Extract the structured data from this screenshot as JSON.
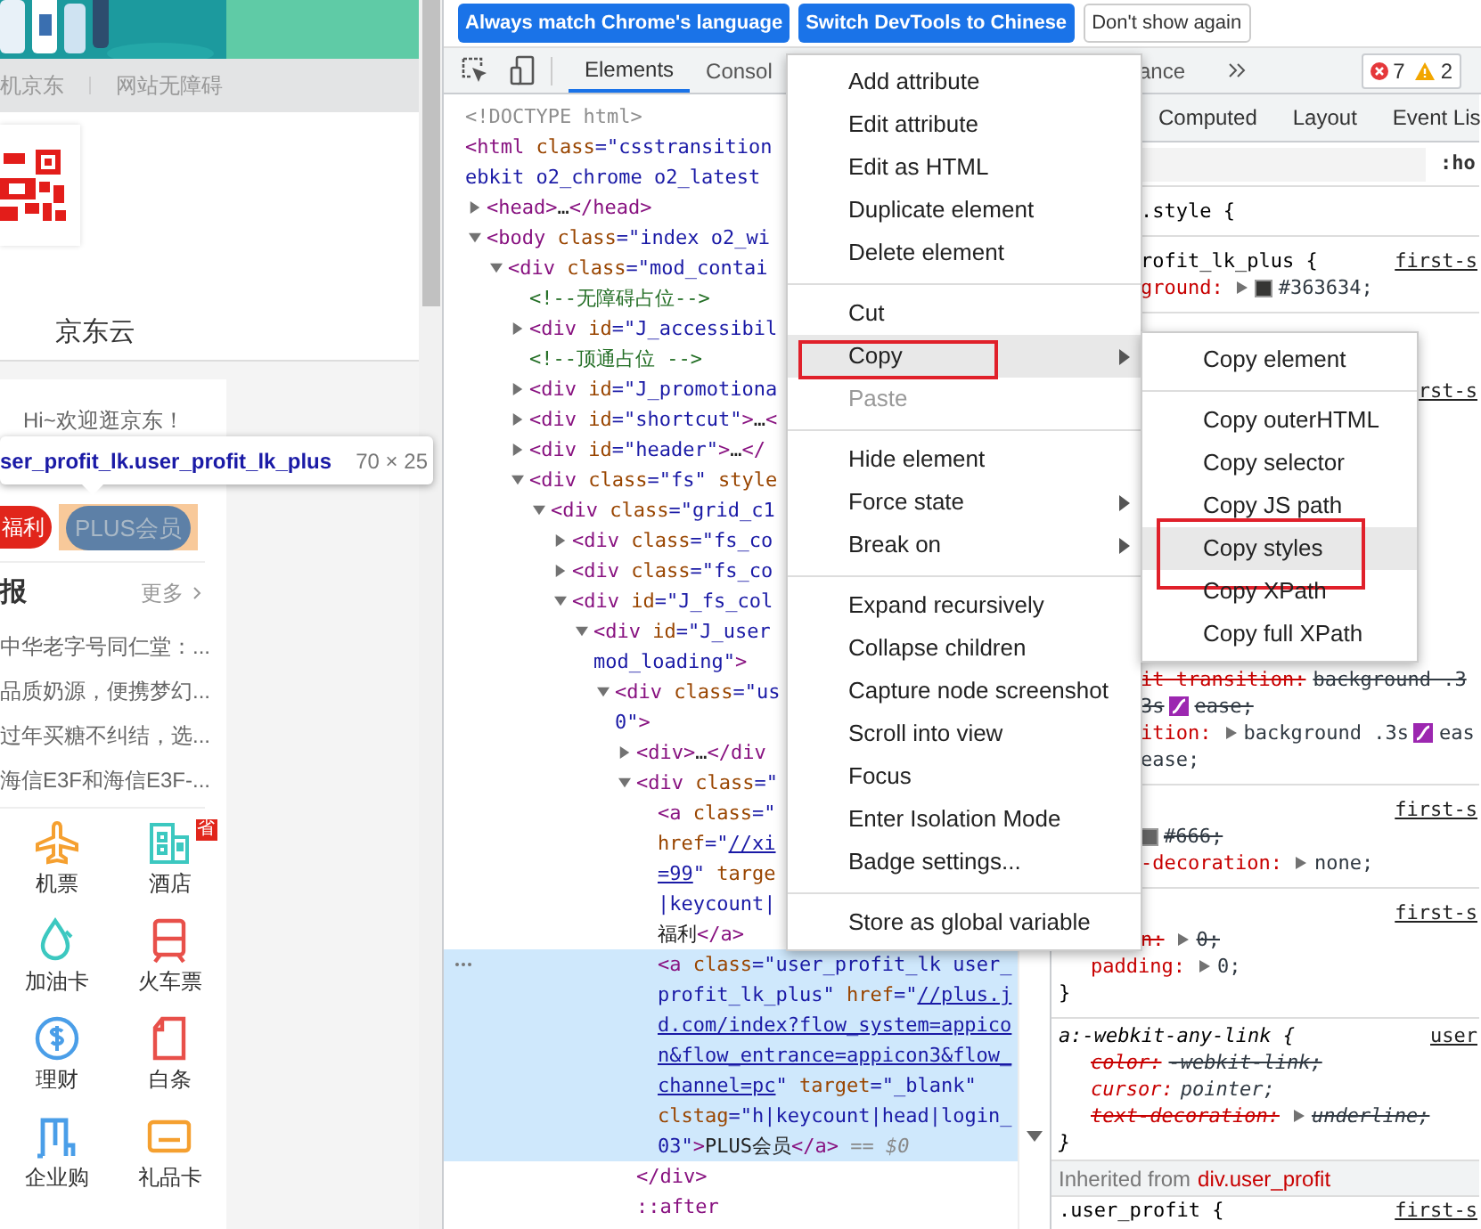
{
  "page": {
    "banner": {
      "kind": "picture"
    },
    "top_links": [
      "机京东",
      "网站无障碍"
    ],
    "nav": [
      "京东云"
    ],
    "greeting": "Hi~欢迎逛京东！",
    "tooltip": {
      "selector": "ser_profit_lk.user_profit_lk_plus",
      "size": "70 × 25"
    },
    "pills": [
      {
        "label": "福利",
        "kind": "red"
      },
      {
        "label": "PLUS会员",
        "kind": "inspected"
      }
    ],
    "news": {
      "title": "报",
      "more": "更多",
      "items": [
        "中华老字号同仁堂：...",
        "品质奶源，便携梦幻...",
        "过年买糖不纠结，选...",
        "海信E3F和海信E3F-..."
      ]
    },
    "services": [
      {
        "label": "机票",
        "kind": "plane",
        "color": "#f5a030"
      },
      {
        "label": "酒店",
        "kind": "hotel",
        "color": "#3cc8c0"
      },
      {
        "label": "加油卡",
        "kind": "fuel",
        "color": "#3cc8c0"
      },
      {
        "label": "火车票",
        "kind": "train",
        "color": "#e8504a"
      },
      {
        "label": "理财",
        "kind": "finance",
        "color": "#4a9ee8"
      },
      {
        "label": "白条",
        "kind": "iou",
        "color": "#e8504a"
      },
      {
        "label": "企业购",
        "kind": "enterprise",
        "color": "#4a9ee8"
      },
      {
        "label": "礼品卡",
        "kind": "card",
        "color": "#f5a030"
      }
    ],
    "service_badge": {
      "text": "省"
    }
  },
  "infobar": {
    "buttons": [
      {
        "label": "Always match Chrome's language",
        "kind": "primary"
      },
      {
        "label": "Switch DevTools to Chinese",
        "kind": "primary"
      },
      {
        "label": "Don't show again",
        "kind": "secondary"
      }
    ]
  },
  "toolbar": {
    "tabs": [
      {
        "label": "Elements",
        "selected": true
      },
      {
        "label": "Consol",
        "selected": false
      },
      {
        "label": "ance",
        "selected": false
      }
    ],
    "errors": "7",
    "warnings": "2"
  },
  "elements": {
    "nodes": [
      {
        "selected": false,
        "lines": [
          [
            {
              "kind": "doctype",
              "text": "<!DOCTYPE html>"
            }
          ]
        ]
      },
      {
        "selected": false,
        "lines": [
          [
            {
              "kind": "tag",
              "text": "<html"
            },
            {
              "kind": "attr",
              "text": " class"
            },
            {
              "kind": "val",
              "text": "=\"csstransition"
            }
          ],
          [
            {
              "kind": "val",
              "text": "ebkit o2_chrome o2_latest"
            }
          ]
        ],
        "children": [
          {
            "selected": false,
            "expanded": false,
            "lines": [
              [
                {
                  "kind": "tag",
                  "text": "<head>"
                },
                {
                  "kind": "text",
                  "text": "…"
                },
                {
                  "kind": "tag",
                  "text": "</head>"
                }
              ]
            ]
          },
          {
            "selected": false,
            "expanded": true,
            "lines": [
              [
                {
                  "kind": "tag",
                  "text": "<body"
                },
                {
                  "kind": "attr",
                  "text": " class"
                },
                {
                  "kind": "val",
                  "text": "=\"index o2_wi"
                }
              ]
            ],
            "children": [
              {
                "selected": false,
                "expanded": true,
                "lines": [
                  [
                    {
                      "kind": "tag",
                      "text": "<div"
                    },
                    {
                      "kind": "attr",
                      "text": " class"
                    },
                    {
                      "kind": "val",
                      "text": "=\"mod_contai"
                    }
                  ]
                ],
                "children": [
                  {
                    "selected": false,
                    "lines": [
                      [
                        {
                          "kind": "comment",
                          "text": "<!--无障碍占位-->"
                        }
                      ]
                    ]
                  },
                  {
                    "selected": false,
                    "expanded": false,
                    "lines": [
                      [
                        {
                          "kind": "tag",
                          "text": "<div"
                        },
                        {
                          "kind": "attr",
                          "text": " id"
                        },
                        {
                          "kind": "val",
                          "text": "=\"J_accessibil"
                        }
                      ]
                    ]
                  },
                  {
                    "selected": false,
                    "lines": [
                      [
                        {
                          "kind": "comment",
                          "text": "<!--顶通占位 -->"
                        }
                      ]
                    ]
                  },
                  {
                    "selected": false,
                    "expanded": false,
                    "lines": [
                      [
                        {
                          "kind": "tag",
                          "text": "<div"
                        },
                        {
                          "kind": "attr",
                          "text": " id"
                        },
                        {
                          "kind": "val",
                          "text": "=\"J_promotiona"
                        }
                      ]
                    ]
                  },
                  {
                    "selected": false,
                    "expanded": false,
                    "lines": [
                      [
                        {
                          "kind": "tag",
                          "text": "<div"
                        },
                        {
                          "kind": "attr",
                          "text": " id"
                        },
                        {
                          "kind": "val",
                          "text": "=\"shortcut\""
                        },
                        {
                          "kind": "tag",
                          "text": ">"
                        },
                        {
                          "kind": "text",
                          "text": "…"
                        },
                        {
                          "kind": "tag",
                          "text": "<"
                        }
                      ]
                    ]
                  },
                  {
                    "selected": false,
                    "expanded": false,
                    "lines": [
                      [
                        {
                          "kind": "tag",
                          "text": "<div"
                        },
                        {
                          "kind": "attr",
                          "text": " id"
                        },
                        {
                          "kind": "val",
                          "text": "=\"header\""
                        },
                        {
                          "kind": "tag",
                          "text": ">"
                        },
                        {
                          "kind": "text",
                          "text": "…"
                        },
                        {
                          "kind": "tag",
                          "text": "</"
                        }
                      ]
                    ]
                  },
                  {
                    "selected": false,
                    "expanded": true,
                    "lines": [
                      [
                        {
                          "kind": "tag",
                          "text": "<div"
                        },
                        {
                          "kind": "attr",
                          "text": " class"
                        },
                        {
                          "kind": "val",
                          "text": "=\"fs\""
                        },
                        {
                          "kind": "attr",
                          "text": " style"
                        }
                      ]
                    ],
                    "children": [
                      {
                        "selected": false,
                        "expanded": true,
                        "lines": [
                          [
                            {
                              "kind": "tag",
                              "text": "<div"
                            },
                            {
                              "kind": "attr",
                              "text": " class"
                            },
                            {
                              "kind": "val",
                              "text": "=\"grid_c1"
                            }
                          ]
                        ],
                        "children": [
                          {
                            "selected": false,
                            "expanded": false,
                            "lines": [
                              [
                                {
                                  "kind": "tag",
                                  "text": "<div"
                                },
                                {
                                  "kind": "attr",
                                  "text": " class"
                                },
                                {
                                  "kind": "val",
                                  "text": "=\"fs_co"
                                }
                              ]
                            ]
                          },
                          {
                            "selected": false,
                            "expanded": false,
                            "lines": [
                              [
                                {
                                  "kind": "tag",
                                  "text": "<div"
                                },
                                {
                                  "kind": "attr",
                                  "text": " class"
                                },
                                {
                                  "kind": "val",
                                  "text": "=\"fs_co"
                                }
                              ]
                            ]
                          },
                          {
                            "selected": false,
                            "expanded": true,
                            "lines": [
                              [
                                {
                                  "kind": "tag",
                                  "text": "<div"
                                },
                                {
                                  "kind": "attr",
                                  "text": " id"
                                },
                                {
                                  "kind": "val",
                                  "text": "=\"J_fs_col"
                                }
                              ]
                            ],
                            "children": [
                              {
                                "selected": false,
                                "expanded": true,
                                "lines": [
                                  [
                                    {
                                      "kind": "tag",
                                      "text": "<div"
                                    },
                                    {
                                      "kind": "attr",
                                      "text": " id"
                                    },
                                    {
                                      "kind": "val",
                                      "text": "=\"J_user"
                                    }
                                  ],
                                  [
                                    {
                                      "kind": "val",
                                      "text": "mod_loading\""
                                    },
                                    {
                                      "kind": "tag",
                                      "text": ">"
                                    }
                                  ]
                                ],
                                "children": [
                                  {
                                    "selected": false,
                                    "expanded": true,
                                    "lines": [
                                      [
                                        {
                                          "kind": "tag",
                                          "text": "<div"
                                        },
                                        {
                                          "kind": "attr",
                                          "text": " class"
                                        },
                                        {
                                          "kind": "val",
                                          "text": "=\"us"
                                        }
                                      ],
                                      [
                                        {
                                          "kind": "val",
                                          "text": "0\""
                                        },
                                        {
                                          "kind": "tag",
                                          "text": ">"
                                        }
                                      ]
                                    ],
                                    "children": [
                                      {
                                        "selected": false,
                                        "expanded": false,
                                        "lines": [
                                          [
                                            {
                                              "kind": "tag",
                                              "text": "<div>"
                                            },
                                            {
                                              "kind": "text",
                                              "text": "…"
                                            },
                                            {
                                              "kind": "tag",
                                              "text": "</div"
                                            }
                                          ]
                                        ]
                                      },
                                      {
                                        "selected": false,
                                        "expanded": true,
                                        "lines": [
                                          [
                                            {
                                              "kind": "tag",
                                              "text": "<div"
                                            },
                                            {
                                              "kind": "attr",
                                              "text": " class"
                                            },
                                            {
                                              "kind": "val",
                                              "text": "=\""
                                            }
                                          ]
                                        ],
                                        "closing": [
                                          {
                                            "kind": "tag",
                                            "text": "</div>"
                                          }
                                        ],
                                        "children": [
                                          {
                                            "selected": false,
                                            "lines": [
                                              [
                                                {
                                                  "kind": "tag",
                                                  "text": "<a"
                                                },
                                                {
                                                  "kind": "attr",
                                                  "text": " class"
                                                },
                                                {
                                                  "kind": "val",
                                                  "text": "=\""
                                                }
                                              ],
                                              [
                                                {
                                                  "kind": "attr",
                                                  "text": "href"
                                                },
                                                {
                                                  "kind": "val",
                                                  "text": "=\""
                                                },
                                                {
                                                  "kind": "link",
                                                  "text": "//xi"
                                                }
                                              ],
                                              [
                                                {
                                                  "kind": "link",
                                                  "text": "=99"
                                                },
                                                {
                                                  "kind": "val",
                                                  "text": "\""
                                                },
                                                {
                                                  "kind": "attr",
                                                  "text": " targe"
                                                }
                                              ],
                                              [
                                                {
                                                  "kind": "val",
                                                  "text": "|keycount|"
                                                }
                                              ],
                                              [
                                                {
                                                  "kind": "text",
                                                  "text": "福利"
                                                },
                                                {
                                                  "kind": "tag",
                                                  "text": "</a>"
                                                }
                                              ]
                                            ]
                                          },
                                          {
                                            "selected": true,
                                            "lines": [
                                              [
                                                {
                                                  "kind": "tag",
                                                  "text": "<a"
                                                },
                                                {
                                                  "kind": "attr",
                                                  "text": " class"
                                                },
                                                {
                                                  "kind": "val",
                                                  "text": "=\"user_profit_lk user_"
                                                }
                                              ],
                                              [
                                                {
                                                  "kind": "val",
                                                  "text": "profit_lk_plus\""
                                                },
                                                {
                                                  "kind": "attr",
                                                  "text": " href"
                                                },
                                                {
                                                  "kind": "val",
                                                  "text": "=\""
                                                },
                                                {
                                                  "kind": "link",
                                                  "text": "//plus.j"
                                                }
                                              ],
                                              [
                                                {
                                                  "kind": "link",
                                                  "text": "d.com/index?flow_system=appico"
                                                }
                                              ],
                                              [
                                                {
                                                  "kind": "link",
                                                  "text": "n&flow_entrance=appicon3&flow_"
                                                }
                                              ],
                                              [
                                                {
                                                  "kind": "link",
                                                  "text": "channel=pc"
                                                },
                                                {
                                                  "kind": "val",
                                                  "text": "\""
                                                },
                                                {
                                                  "kind": "attr",
                                                  "text": " target"
                                                },
                                                {
                                                  "kind": "val",
                                                  "text": "=\"_blank\""
                                                }
                                              ],
                                              [
                                                {
                                                  "kind": "attr",
                                                  "text": "clstag"
                                                },
                                                {
                                                  "kind": "val",
                                                  "text": "=\"h|keycount|head|login_"
                                                }
                                              ],
                                              [
                                                {
                                                  "kind": "val",
                                                  "text": "03\""
                                                },
                                                {
                                                  "kind": "tag",
                                                  "text": ">"
                                                },
                                                {
                                                  "kind": "text",
                                                  "text": "PLUS会员"
                                                },
                                                {
                                                  "kind": "tag",
                                                  "text": "</a>"
                                                },
                                                {
                                                  "kind": "dim",
                                                  "text": " == $0"
                                                }
                                              ]
                                            ]
                                          }
                                        ]
                                      },
                                      {
                                        "selected": false,
                                        "lines": [
                                          [
                                            {
                                              "kind": "pseudo",
                                              "text": "::after"
                                            }
                                          ]
                                        ]
                                      }
                                    ]
                                  }
                                ]
                              }
                            ]
                          }
                        ]
                      }
                    ]
                  }
                ]
              }
            ]
          }
        ]
      }
    ]
  },
  "styles": {
    "tabs": [
      {
        "label": "Computed",
        "selected": false
      },
      {
        "label": "Layout",
        "selected": false
      },
      {
        "label": "Event Lis",
        "selected": false
      }
    ],
    "hover_toggle": ":ho",
    "rules": [
      {
        "kind": "plain",
        "lines": [
          {
            "kind": "cut",
            "parts": [
              {
                "kind": "selector",
                "text": ".style {"
              }
            ]
          }
        ]
      },
      {
        "kind": "plain",
        "lines": [
          {
            "kind": "cut",
            "source": "first-s",
            "parts": [
              {
                "kind": "selector",
                "text": "rofit_lk_plus {"
              }
            ]
          },
          {
            "kind": "cut",
            "struck": false,
            "parts": [
              {
                "kind": "prop",
                "text": "ground:"
              },
              {
                "kind": "expander"
              },
              {
                "kind": "swatch",
                "color": "#363634"
              },
              {
                "kind": "value",
                "text": "#363634;"
              }
            ]
          }
        ]
      },
      {
        "kind": "covered",
        "lines": [
          {
            "kind": "cut",
            "source": "rst-s"
          },
          {
            "kind": "cut",
            "struck": true,
            "parts": [
              {
                "kind": "prop",
                "text": "it transition:"
              },
              {
                "kind": "value",
                "text": "background .3"
              }
            ]
          },
          {
            "kind": "cut",
            "struck": true,
            "parts": [
              {
                "kind": "value",
                "text": "3s"
              },
              {
                "kind": "easing"
              },
              {
                "kind": "value",
                "text": "ease;"
              }
            ]
          },
          {
            "kind": "cut",
            "struck": false,
            "parts": [
              {
                "kind": "prop",
                "text": "ition:"
              },
              {
                "kind": "expander"
              },
              {
                "kind": "value",
                "text": "background .3s"
              },
              {
                "kind": "easing"
              },
              {
                "kind": "value",
                "text": "eas"
              }
            ]
          },
          {
            "kind": "cut",
            "struck": false,
            "parts": [
              {
                "kind": "value",
                "text": "ease;"
              }
            ]
          }
        ]
      },
      {
        "kind": "plain",
        "lines": [
          {
            "kind": "cut",
            "source": "first-s"
          },
          {
            "kind": "cut",
            "struck": true,
            "parts": [
              {
                "kind": "swatch",
                "color": "#666666"
              },
              {
                "kind": "value",
                "text": "#666;"
              }
            ]
          },
          {
            "kind": "cut",
            "struck": false,
            "parts": [
              {
                "kind": "prop",
                "text": "-decoration:"
              },
              {
                "kind": "expander"
              },
              {
                "kind": "value",
                "text": "none;"
              }
            ]
          }
        ]
      },
      {
        "kind": "plain",
        "lines": [
          {
            "kind": "cut",
            "source": "first-s"
          },
          {
            "kind": "cut",
            "struck": true,
            "parts": [
              {
                "kind": "prop",
                "text": "n:"
              },
              {
                "kind": "expander"
              },
              {
                "kind": "value",
                "text": "0;"
              }
            ]
          },
          {
            "kind": "decl",
            "struck": false,
            "parts": [
              {
                "kind": "prop",
                "text": "padding:"
              },
              {
                "kind": "expander"
              },
              {
                "kind": "value",
                "text": "0;"
              }
            ]
          },
          {
            "kind": "brace",
            "parts": [
              {
                "kind": "selector",
                "text": "}"
              }
            ]
          }
        ]
      },
      {
        "kind": "user_agent",
        "lines": [
          {
            "kind": "selector",
            "source": "user",
            "parts": [
              {
                "kind": "selector",
                "text": "a:-webkit-any-link {"
              }
            ]
          },
          {
            "kind": "decl",
            "struck": true,
            "parts": [
              {
                "kind": "prop",
                "text": "color:"
              },
              {
                "kind": "value",
                "text": "-webkit-link;"
              }
            ]
          },
          {
            "kind": "decl",
            "struck": false,
            "parts": [
              {
                "kind": "prop",
                "text": "cursor:"
              },
              {
                "kind": "value",
                "text": "pointer;"
              }
            ]
          },
          {
            "kind": "decl",
            "struck": true,
            "parts": [
              {
                "kind": "prop",
                "text": "text-decoration:"
              },
              {
                "kind": "expander"
              },
              {
                "kind": "value",
                "text": "underline;"
              }
            ]
          },
          {
            "kind": "brace",
            "parts": [
              {
                "kind": "selector",
                "text": "}"
              }
            ]
          }
        ]
      }
    ],
    "inherited": {
      "label": "Inherited from",
      "element": "div.user_profit",
      "lines": [
        {
          "kind": "selector",
          "source": "first-s",
          "parts": [
            {
              "kind": "selector",
              "text": ".user_profit {"
            }
          ]
        }
      ]
    }
  },
  "context_menu": {
    "items": [
      {
        "kind": "item",
        "label": "Add attribute",
        "selected": false,
        "disabled": false,
        "submenu": false,
        "marked": false
      },
      {
        "kind": "item",
        "label": "Edit attribute",
        "selected": false,
        "disabled": false,
        "submenu": false,
        "marked": false
      },
      {
        "kind": "item",
        "label": "Edit as HTML",
        "selected": false,
        "disabled": false,
        "submenu": false,
        "marked": false
      },
      {
        "kind": "item",
        "label": "Duplicate element",
        "selected": false,
        "disabled": false,
        "submenu": false,
        "marked": false
      },
      {
        "kind": "item",
        "label": "Delete element",
        "selected": false,
        "disabled": false,
        "submenu": false,
        "marked": false
      },
      {
        "kind": "separator"
      },
      {
        "kind": "item",
        "label": "Cut",
        "selected": false,
        "disabled": false,
        "submenu": false,
        "marked": false
      },
      {
        "kind": "item",
        "label": "Copy",
        "selected": true,
        "disabled": false,
        "submenu": true,
        "marked": true
      },
      {
        "kind": "item",
        "label": "Paste",
        "selected": false,
        "disabled": true,
        "submenu": false,
        "marked": false
      },
      {
        "kind": "separator"
      },
      {
        "kind": "item",
        "label": "Hide element",
        "selected": false,
        "disabled": false,
        "submenu": false,
        "marked": false
      },
      {
        "kind": "item",
        "label": "Force state",
        "selected": false,
        "disabled": false,
        "submenu": true,
        "marked": false
      },
      {
        "kind": "item",
        "label": "Break on",
        "selected": false,
        "disabled": false,
        "submenu": true,
        "marked": false
      },
      {
        "kind": "separator"
      },
      {
        "kind": "item",
        "label": "Expand recursively",
        "selected": false,
        "disabled": false,
        "submenu": false,
        "marked": false
      },
      {
        "kind": "item",
        "label": "Collapse children",
        "selected": false,
        "disabled": false,
        "submenu": false,
        "marked": false
      },
      {
        "kind": "item",
        "label": "Capture node screenshot",
        "selected": false,
        "disabled": false,
        "submenu": false,
        "marked": false
      },
      {
        "kind": "item",
        "label": "Scroll into view",
        "selected": false,
        "disabled": false,
        "submenu": false,
        "marked": false
      },
      {
        "kind": "item",
        "label": "Focus",
        "selected": false,
        "disabled": false,
        "submenu": false,
        "marked": false
      },
      {
        "kind": "item",
        "label": "Enter Isolation Mode",
        "selected": false,
        "disabled": false,
        "submenu": false,
        "marked": false
      },
      {
        "kind": "item",
        "label": "Badge settings...",
        "selected": false,
        "disabled": false,
        "submenu": false,
        "marked": false
      },
      {
        "kind": "separator"
      },
      {
        "kind": "item",
        "label": "Store as global variable",
        "selected": false,
        "disabled": false,
        "submenu": false,
        "marked": false
      }
    ]
  },
  "submenu": {
    "items": [
      {
        "kind": "item",
        "label": "Copy element",
        "selected": false,
        "disabled": false,
        "submenu": false,
        "marked": false
      },
      {
        "kind": "separator"
      },
      {
        "kind": "item",
        "label": "Copy outerHTML",
        "selected": false,
        "disabled": false,
        "submenu": false,
        "marked": false
      },
      {
        "kind": "item",
        "label": "Copy selector",
        "selected": false,
        "disabled": false,
        "submenu": false,
        "marked": false
      },
      {
        "kind": "item",
        "label": "Copy JS path",
        "selected": false,
        "disabled": false,
        "submenu": false,
        "marked": false
      },
      {
        "kind": "item",
        "label": "Copy styles",
        "selected": true,
        "disabled": false,
        "submenu": false,
        "marked": true
      },
      {
        "kind": "item",
        "label": "Copy XPath",
        "selected": false,
        "disabled": false,
        "submenu": false,
        "marked": false
      },
      {
        "kind": "item",
        "label": "Copy full XPath",
        "selected": false,
        "disabled": false,
        "submenu": false,
        "marked": false
      }
    ]
  }
}
